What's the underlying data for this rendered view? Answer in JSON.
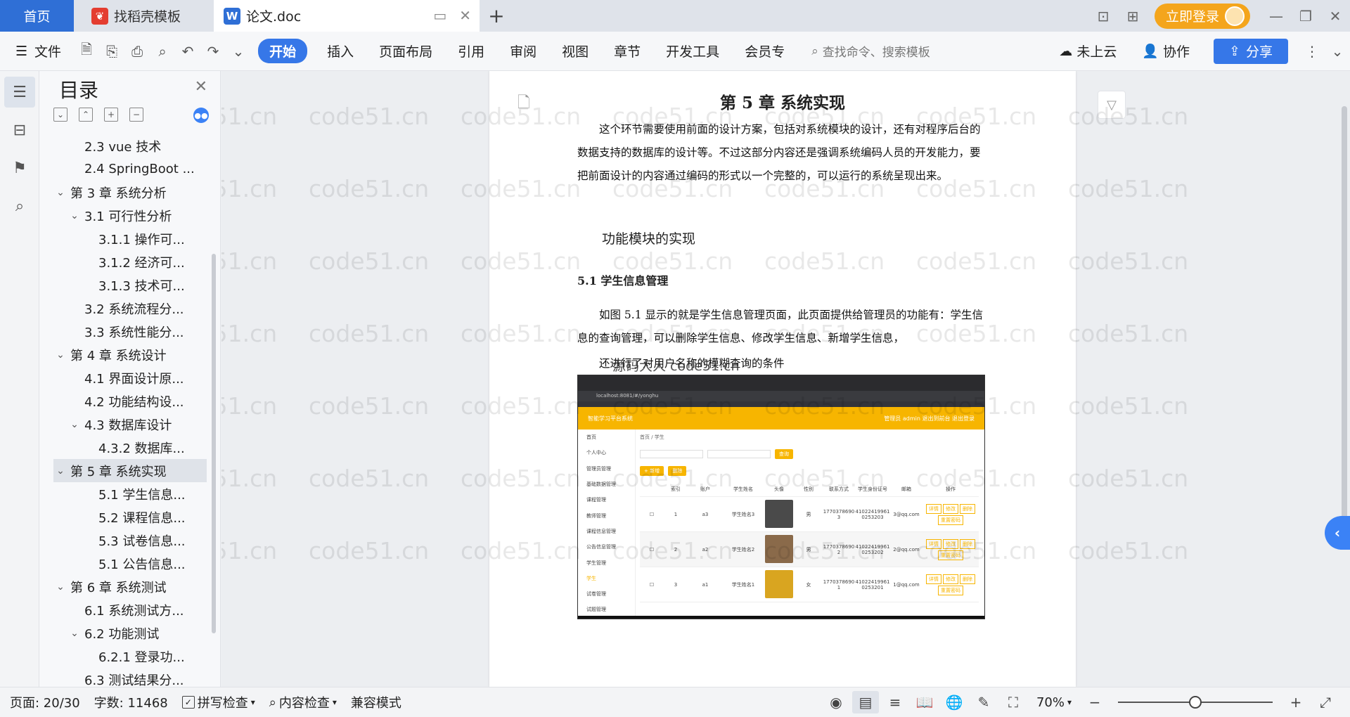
{
  "tabs": {
    "home": "首页",
    "template": "找稻壳模板",
    "doc": "论文.doc"
  },
  "titlebar": {
    "login_label": "立即登录"
  },
  "ribbon": {
    "file": "文件",
    "tabs": [
      "开始",
      "插入",
      "页面布局",
      "引用",
      "审阅",
      "视图",
      "章节",
      "开发工具",
      "会员专"
    ],
    "search_placeholder": "查找命令、搜索模板",
    "cloud": "未上云",
    "collab": "协作",
    "share": "分享"
  },
  "toc": {
    "title": "目录",
    "items": [
      {
        "label": "2.3 vue 技术",
        "level": 2,
        "caret": ""
      },
      {
        "label": "2.4 SpringBoot ...",
        "level": 2,
        "caret": ""
      },
      {
        "label": "第 3 章  系统分析",
        "level": 1,
        "caret": "⌵"
      },
      {
        "label": "3.1 可行性分析",
        "level": 2,
        "caret": "⌵"
      },
      {
        "label": "3.1.1 操作可...",
        "level": 3,
        "caret": ""
      },
      {
        "label": "3.1.2 经济可...",
        "level": 3,
        "caret": ""
      },
      {
        "label": "3.1.3 技术可...",
        "level": 3,
        "caret": ""
      },
      {
        "label": "3.2 系统流程分...",
        "level": 2,
        "caret": ""
      },
      {
        "label": "3.3 系统性能分...",
        "level": 2,
        "caret": ""
      },
      {
        "label": "第 4 章  系统设计",
        "level": 1,
        "caret": "⌵"
      },
      {
        "label": "4.1 界面设计原...",
        "level": 2,
        "caret": ""
      },
      {
        "label": "4.2 功能结构设...",
        "level": 2,
        "caret": ""
      },
      {
        "label": "4.3 数据库设计",
        "level": 2,
        "caret": "⌵"
      },
      {
        "label": "4.3.2  数据库...",
        "level": 3,
        "caret": ""
      },
      {
        "label": "第 5 章  系统实现",
        "level": 1,
        "caret": "⌵",
        "active": true
      },
      {
        "label": "5.1 学生信息...",
        "level": 3,
        "caret": ""
      },
      {
        "label": "5.2  课程信息...",
        "level": 3,
        "caret": ""
      },
      {
        "label": "5.3 试卷信息...",
        "level": 3,
        "caret": ""
      },
      {
        "label": "5.1 公告信息...",
        "level": 3,
        "caret": ""
      },
      {
        "label": "第 6 章  系统测试",
        "level": 1,
        "caret": "⌵"
      },
      {
        "label": "6.1  系统测试方...",
        "level": 2,
        "caret": ""
      },
      {
        "label": "6.2  功能测试",
        "level": 2,
        "caret": "⌵"
      },
      {
        "label": "6.2.1  登录功...",
        "level": 3,
        "caret": ""
      },
      {
        "label": "6.3  测试结果分...",
        "level": 2,
        "caret": ""
      }
    ]
  },
  "document": {
    "chapter_title": "第 5 章  系统实现",
    "intro": "这个环节需要使用前面的设计方案，包括对系统模块的设计，还有对程序后台的数据支持的数据库的设计等。不过这部分内容还是强调系统编码人员的开发能力，要把前面设计的内容通过编码的形式以一个完整的，可以运行的系统呈现出来。",
    "func_heading": "功能模块的实现",
    "section_heading": "5.1 学生信息管理",
    "section_para": "如图 5.1 显示的就是学生信息管理页面，此页面提供给管理员的功能有：学生信息的查询管理，可以删除学生信息、修改学生信息、新增学生信息，",
    "section_para2": "还进行了对用户名称的模糊查询的条件",
    "overlay_note": "源码大人 code51.cn"
  },
  "screenshot": {
    "url": "localhost:8081/#/yonghu",
    "app_title": "智能学习平台系统",
    "header_right": "管理员 admin    退出到前台    退出登录",
    "breadcrumb": "首页 / 学生",
    "search_btn": "查询",
    "add_btn": "+ 新增",
    "del_btn": "删除",
    "side_items": [
      "首页",
      "个人中心",
      "管理员管理",
      "基础数据管理",
      "课程管理",
      "教师管理",
      "课程信息管理",
      "公告信息管理",
      "学生管理",
      "学生",
      "试卷管理",
      "试题管理"
    ],
    "columns": [
      "索引",
      "账户",
      "学生姓名",
      "头像",
      "性别",
      "联系方式",
      "学生身份证号",
      "邮箱",
      "操作"
    ],
    "rows": [
      {
        "idx": "1",
        "acct": "a3",
        "name": "学生姓名3",
        "sex": "男",
        "phone": "17703786903",
        "id": "410224199610253203",
        "email": "3@qq.com"
      },
      {
        "idx": "2",
        "acct": "a2",
        "name": "学生姓名2",
        "sex": "男",
        "phone": "17703786902",
        "id": "410224199610253202",
        "email": "2@qq.com"
      },
      {
        "idx": "3",
        "acct": "a1",
        "name": "学生姓名1",
        "sex": "女",
        "phone": "17703786901",
        "id": "410224199610253201",
        "email": "1@qq.com"
      }
    ],
    "actions": [
      "详情",
      "修改",
      "删除",
      "重置密码"
    ]
  },
  "statusbar": {
    "page": "页面: 20/30",
    "words": "字数: 11468",
    "spell": "拼写检查",
    "content_check": "内容检查",
    "compat": "兼容模式",
    "zoom": "70%",
    "zoom_level": 0.5
  },
  "watermark": "code51.cn"
}
